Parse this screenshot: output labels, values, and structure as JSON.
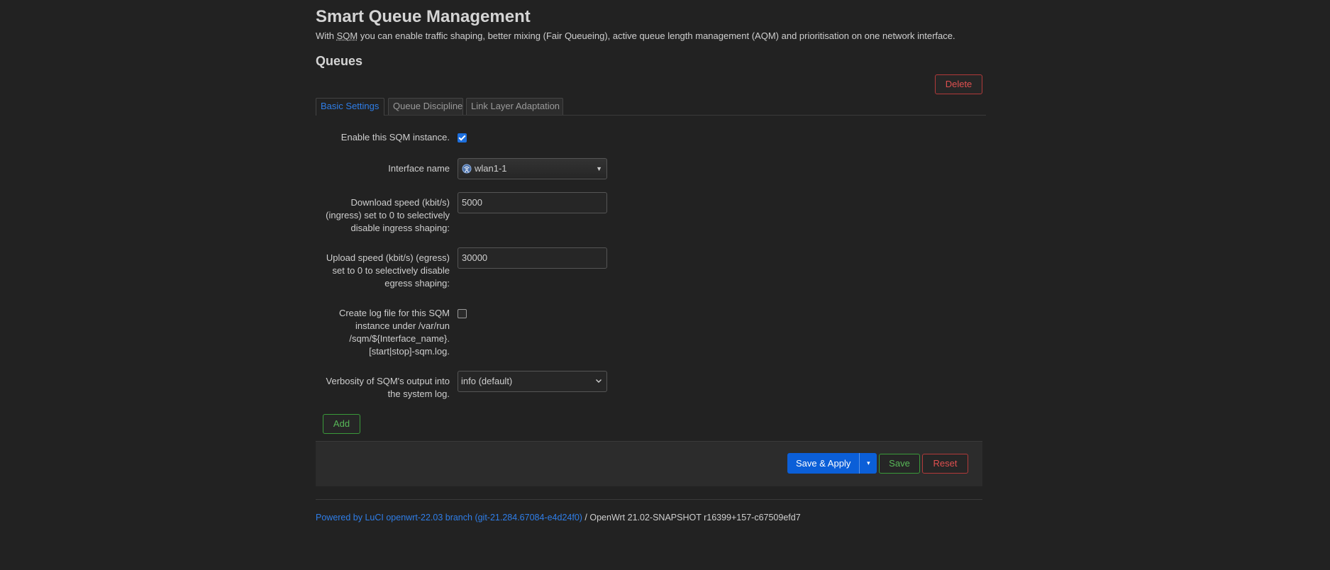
{
  "header": {
    "title": "Smart Queue Management",
    "description_prefix": "With ",
    "description_abbr": "SQM",
    "description_suffix": " you can enable traffic shaping, better mixing (Fair Queueing), active queue length management (AQM) and prioritisation on one network interface."
  },
  "section": {
    "title": "Queues",
    "delete_label": "Delete",
    "add_label": "Add"
  },
  "tabs": [
    {
      "label": "Basic Settings",
      "active": true
    },
    {
      "label": "Queue Discipline",
      "active": false
    },
    {
      "label": "Link Layer Adaptation",
      "active": false
    }
  ],
  "form": {
    "enable": {
      "label": "Enable this SQM instance.",
      "checked": true
    },
    "interface": {
      "label": "Interface name",
      "value": "wlan1-1",
      "icon": "wireless-interface-icon"
    },
    "download": {
      "label": "Download speed (kbit/s) (ingress) set to 0 to selectively disable ingress shaping:",
      "value": "5000"
    },
    "upload": {
      "label": "Upload speed (kbit/s) (egress) set to 0 to selectively disable egress shaping:",
      "value": "30000"
    },
    "logfile": {
      "label": "Create log file for this SQM instance under /var/run /sqm/${Interface_name}. [start|stop]-sqm.log.",
      "checked": false
    },
    "verbosity": {
      "label": "Verbosity of SQM's output into the system log.",
      "value": "info (default)"
    }
  },
  "actions": {
    "save_apply_label": "Save & Apply",
    "save_apply_dropdown": "▾",
    "save_label": "Save",
    "reset_label": "Reset"
  },
  "footer": {
    "link_text": "Powered by LuCI openwrt-22.03 branch (git-21.284.67084-e4d24f0)",
    "version_text": " / OpenWrt 21.02-SNAPSHOT r16399+157-c67509efd7"
  },
  "colors": {
    "background": "#222222",
    "accent_blue": "#0b5fd8",
    "link_blue": "#2f7ee8",
    "danger_red": "#e05050",
    "positive_green": "#58b858"
  }
}
